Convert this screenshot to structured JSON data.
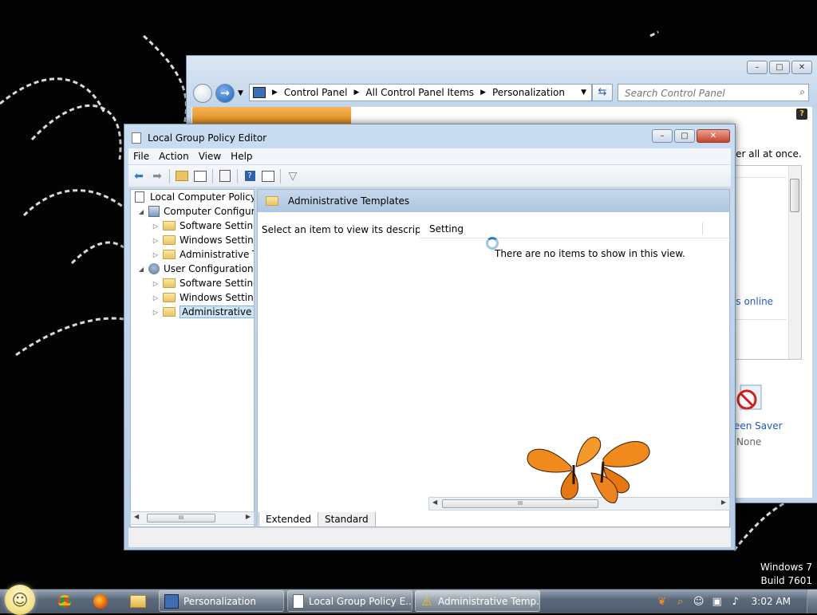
{
  "desktop": {
    "watermark_line1": "Windows 7",
    "watermark_line2": "Build 7601"
  },
  "control_panel": {
    "breadcrumb": [
      "Control Panel",
      "All Control Panel Items",
      "Personalization"
    ],
    "search_placeholder": "Search Control Panel",
    "partial_text": "ver all at once.",
    "partial_link": "es online",
    "screen_saver_label": "een Saver",
    "screen_saver_value": "None"
  },
  "gpe": {
    "title": "Local Group Policy Editor",
    "menu": [
      "File",
      "Action",
      "View",
      "Help"
    ],
    "tree": {
      "root": "Local Computer Policy",
      "computer_config": "Computer Configura",
      "cc_software": "Software Settings",
      "cc_windows": "Windows Setting",
      "cc_admin": "Administrative Te",
      "user_config": "User Configuration",
      "uc_software": "Software Settings",
      "uc_windows": "Windows Setting",
      "uc_admin": "Administrative Te"
    },
    "right": {
      "header": "Administrative Templates",
      "description": "Select an item to view its description.",
      "column_setting": "Setting",
      "empty_message": "There are no items to show in this view."
    },
    "tabs": [
      "Extended",
      "Standard"
    ]
  },
  "taskbar": {
    "buttons": [
      {
        "label": "Personalization"
      },
      {
        "label": "Local Group Policy E..."
      },
      {
        "label": "Administrative Temp..."
      }
    ],
    "clock": "3:02 AM"
  },
  "colors": {
    "accent_blue": "#1e5db8",
    "selection": "#cce4f7",
    "orange_header": "#e38a1d"
  }
}
